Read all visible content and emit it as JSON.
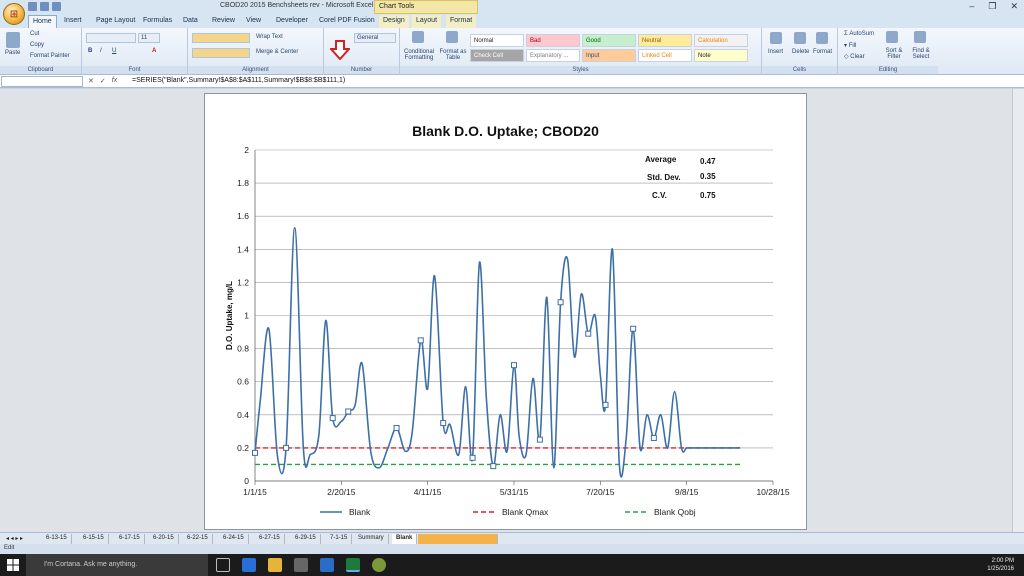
{
  "window": {
    "title": "CBOD20 2015 Benchsheets rev - Microsoft Excel",
    "context_tab": "Chart Tools"
  },
  "ribbon_tabs": [
    "Home",
    "Insert",
    "Page Layout",
    "Formulas",
    "Data",
    "Review",
    "View",
    "Developer",
    "Corel PDF Fusion",
    "Design",
    "Layout",
    "Format"
  ],
  "ribbon": {
    "clipboard": {
      "label": "Clipboard",
      "paste": "Paste",
      "cut": "Cut",
      "copy": "Copy",
      "format_painter": "Format Painter"
    },
    "font": {
      "label": "Font",
      "font_size": "11"
    },
    "alignment": {
      "label": "Alignment",
      "wrap_text": "Wrap Text",
      "merge_center": "Merge & Center"
    },
    "number": {
      "label": "Number",
      "format": "General"
    },
    "styles": {
      "label": "Styles",
      "conditional_formatting": "Conditional Formatting",
      "format_as_table": "Format as Table",
      "cells": [
        {
          "name": "Normal",
          "bg": "#ffffff",
          "fg": "#222222"
        },
        {
          "name": "Bad",
          "bg": "#ffc7ce",
          "fg": "#9c0006"
        },
        {
          "name": "Good",
          "bg": "#c6efce",
          "fg": "#006100"
        },
        {
          "name": "Neutral",
          "bg": "#ffeb9c",
          "fg": "#9c5700"
        },
        {
          "name": "Calculation",
          "bg": "#f2f2f2",
          "fg": "#fa7d00"
        },
        {
          "name": "Check Cell",
          "bg": "#a5a5a5",
          "fg": "#ffffff"
        },
        {
          "name": "Explanatory ...",
          "bg": "#ffffff",
          "fg": "#7f7f7f"
        },
        {
          "name": "Input",
          "bg": "#ffcc99",
          "fg": "#3f3f76"
        },
        {
          "name": "Linked Cell",
          "bg": "#ffffff",
          "fg": "#fa7d00"
        },
        {
          "name": "Note",
          "bg": "#ffffcc",
          "fg": "#222222"
        }
      ]
    },
    "cells_group": {
      "label": "Cells",
      "insert": "Insert",
      "delete": "Delete",
      "format": "Format"
    },
    "editing": {
      "label": "Editing",
      "autosum": "AutoSum",
      "fill": "Fill",
      "clear": "Clear",
      "sort_filter": "Sort & Filter",
      "find_select": "Find & Select"
    }
  },
  "formula_bar": {
    "fx": "fx",
    "formula": "=SERIES(\"Blank\",Summary!$A$8:$A$111,Summary!$B$8:$B$111,1)"
  },
  "stats": {
    "average_label": "Average",
    "average_value": "0.47",
    "stddev_label": "Std. Dev.",
    "stddev_value": "0.35",
    "cv_label": "C.V.",
    "cv_value": "0.75"
  },
  "chart_data": {
    "type": "line",
    "title": "Blank D.O. Uptake; CBOD20",
    "xlabel": "",
    "ylabel": "D.O. Uptake, mg/L",
    "ylim": [
      0,
      2
    ],
    "yticks": [
      "0",
      "0.2",
      "0.4",
      "0.6",
      "0.8",
      "1",
      "1.2",
      "1.4",
      "1.6",
      "1.8",
      "2"
    ],
    "xticks": [
      "1/1/15",
      "2/20/15",
      "4/11/15",
      "5/31/15",
      "7/20/15",
      "9/8/15",
      "10/28/15"
    ],
    "xlim": [
      "2015-01-01",
      "2015-10-28"
    ],
    "grid": true,
    "legend_position": "bottom",
    "series": [
      {
        "name": "Blank",
        "color": "#3d6fa8",
        "style": "solid",
        "x": [
          "2015-01-01",
          "2015-01-04",
          "2015-01-09",
          "2015-01-14",
          "2015-01-19",
          "2015-01-24",
          "2015-01-29",
          "2015-02-02",
          "2015-02-07",
          "2015-02-11",
          "2015-02-15",
          "2015-02-20",
          "2015-02-24",
          "2015-02-28",
          "2015-03-04",
          "2015-03-09",
          "2015-03-14",
          "2015-03-19",
          "2015-03-24",
          "2015-03-29",
          "2015-04-02",
          "2015-04-07",
          "2015-04-11",
          "2015-04-15",
          "2015-04-20",
          "2015-04-24",
          "2015-04-29",
          "2015-05-03",
          "2015-05-07",
          "2015-05-11",
          "2015-05-15",
          "2015-05-19",
          "2015-05-23",
          "2015-05-27",
          "2015-05-31",
          "2015-06-03",
          "2015-06-07",
          "2015-06-11",
          "2015-06-15",
          "2015-06-19",
          "2015-06-23",
          "2015-06-27",
          "2015-07-01",
          "2015-07-05",
          "2015-07-09",
          "2015-07-13",
          "2015-07-17",
          "2015-07-20",
          "2015-07-23",
          "2015-07-27",
          "2015-07-31",
          "2015-08-04",
          "2015-08-08",
          "2015-08-12",
          "2015-08-16",
          "2015-08-20",
          "2015-08-24",
          "2015-08-28",
          "2015-09-01",
          "2015-09-05",
          "2015-09-08",
          "2015-09-11",
          "2015-09-15",
          "2015-09-19",
          "2015-09-23",
          "2015-09-27",
          "2015-10-01",
          "2015-10-05",
          "2015-10-09"
        ],
        "values": [
          0.17,
          0.48,
          0.92,
          0.15,
          0.2,
          1.53,
          0.2,
          0.16,
          0.28,
          0.97,
          0.38,
          0.36,
          0.42,
          0.46,
          0.71,
          0.18,
          0.08,
          0.2,
          0.32,
          0.18,
          0.29,
          0.85,
          0.56,
          1.24,
          0.35,
          0.34,
          0.16,
          0.57,
          0.14,
          1.32,
          0.5,
          0.09,
          0.4,
          0.18,
          0.7,
          0.27,
          0.16,
          0.62,
          0.25,
          1.11,
          0.08,
          1.08,
          1.34,
          0.75,
          1.13,
          0.89,
          1.0,
          0.64,
          0.46,
          1.4,
          0.1,
          0.26,
          0.92,
          0.2,
          0.4,
          0.26,
          0.4,
          0.2,
          0.54,
          0.2,
          0.2,
          0.2,
          0.2,
          0.2,
          0.2,
          0.2,
          0.2,
          0.2,
          0.2
        ]
      },
      {
        "name": "Blank Qmax",
        "color": "#e02020",
        "style": "dashed",
        "values": [
          0.2,
          0.2
        ]
      },
      {
        "name": "Blank Qobj",
        "color": "#2aa040",
        "style": "dashed",
        "values": [
          0.1,
          0.1
        ]
      }
    ]
  },
  "sheet_tabs": [
    "6-13-15",
    "6-15-15",
    "6-17-15",
    "6-20-15",
    "6-22-15",
    "6-24-15",
    "6-27-15",
    "6-29-15",
    "7-1-15",
    "Summary",
    "Blank"
  ],
  "status": {
    "mode": "Edit"
  },
  "taskbar": {
    "search_placeholder": "I'm Cortana. Ask me anything.",
    "time": "2:00 PM",
    "date": "1/25/2016"
  }
}
